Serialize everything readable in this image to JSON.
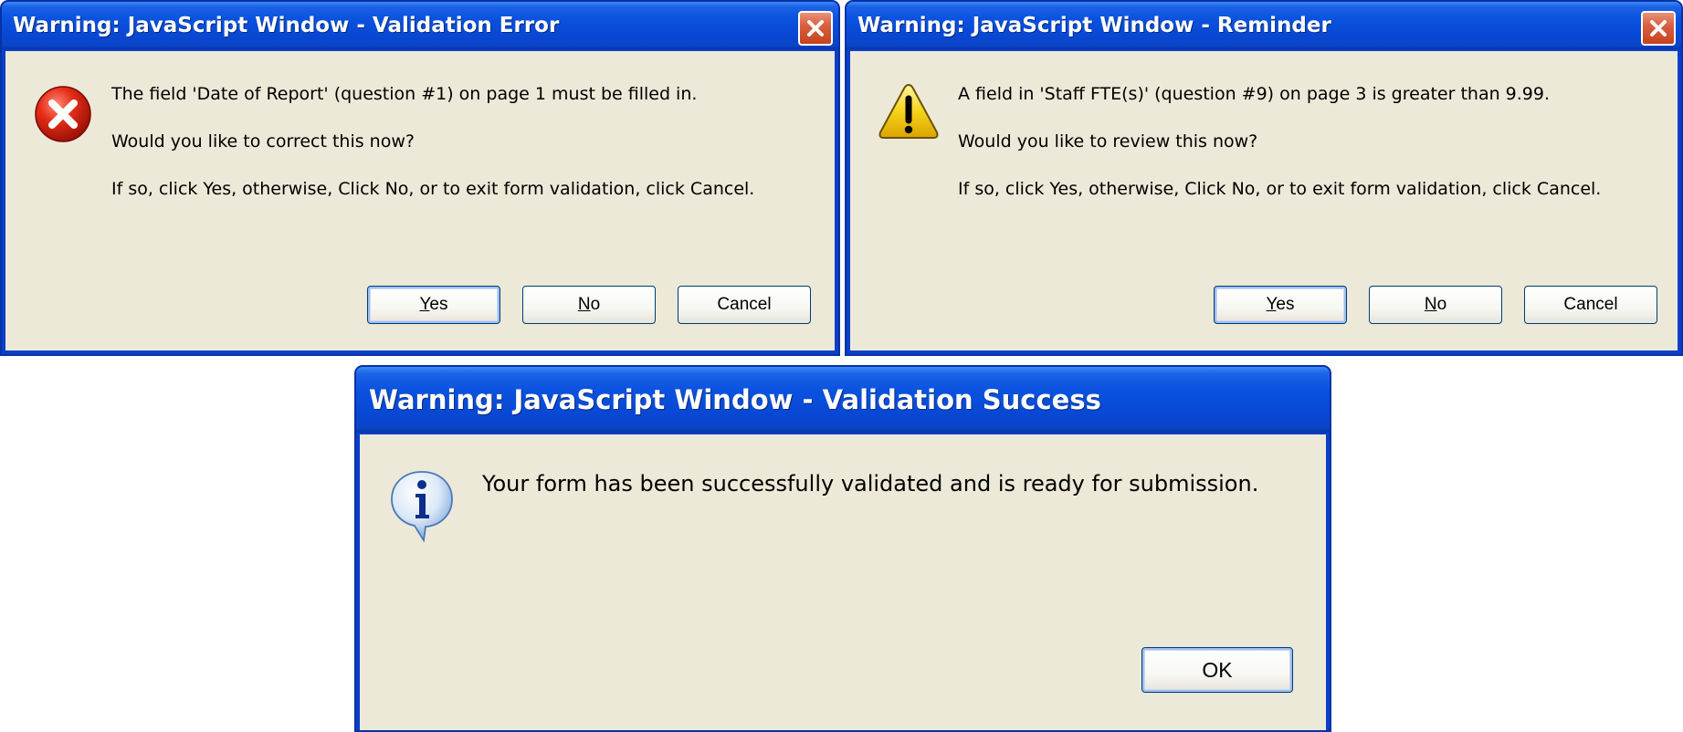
{
  "dialogs": {
    "error": {
      "title": "Warning: JavaScript Window - Validation Error",
      "icon": "error-icon",
      "lines": [
        "The field 'Date of Report' (question #1) on page 1 must be filled in.",
        "Would you like to correct this now?",
        "If so, click Yes, otherwise, Click No, or to exit form validation, click Cancel."
      ],
      "buttons": {
        "yes": {
          "underline": "Y",
          "rest": "es"
        },
        "no": {
          "underline": "N",
          "rest": "o"
        },
        "cancel": "Cancel"
      }
    },
    "reminder": {
      "title": "Warning: JavaScript Window - Reminder",
      "icon": "warning-icon",
      "lines": [
        "A field in 'Staff FTE(s)' (question #9) on page 3 is greater than 9.99.",
        "Would you like to review this now?",
        "If so, click Yes, otherwise, Click No, or to exit form validation, click Cancel."
      ],
      "buttons": {
        "yes": {
          "underline": "Y",
          "rest": "es"
        },
        "no": {
          "underline": "N",
          "rest": "o"
        },
        "cancel": "Cancel"
      }
    },
    "success": {
      "title": "Warning: JavaScript Window - Validation Success",
      "icon": "info-icon",
      "lines": [
        "Your form has been successfully validated and is ready for submission."
      ],
      "buttons": {
        "ok": "OK"
      }
    }
  },
  "colors": {
    "titlebar": "#0a52e0",
    "frame": "#0a3fc8",
    "client": "#ece9d8",
    "close": "#d86040"
  }
}
